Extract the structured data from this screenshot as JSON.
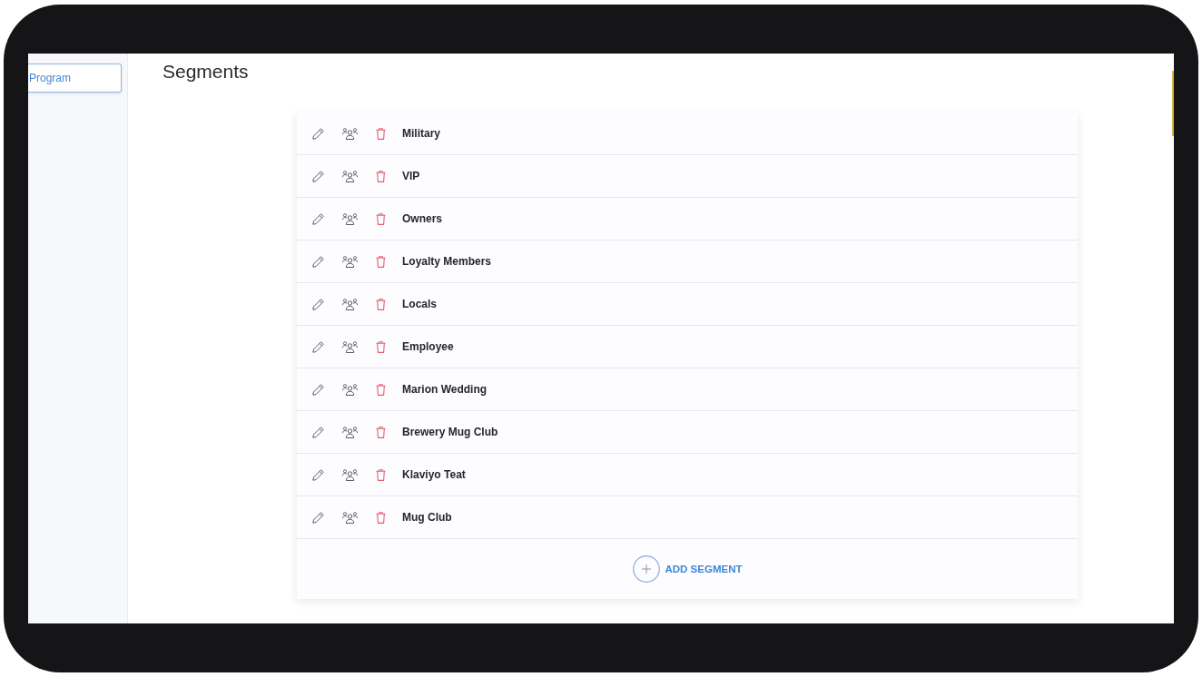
{
  "sidebar": {
    "button": "Program"
  },
  "page": {
    "title": "Segments"
  },
  "segments": [
    {
      "name": "Military"
    },
    {
      "name": "VIP"
    },
    {
      "name": "Owners"
    },
    {
      "name": "Loyalty Members"
    },
    {
      "name": "Locals"
    },
    {
      "name": "Employee"
    },
    {
      "name": "Marion Wedding"
    },
    {
      "name": "Brewery Mug Club"
    },
    {
      "name": "Klaviyo Teat"
    },
    {
      "name": "Mug Club"
    }
  ],
  "add_button": {
    "label": "ADD SEGMENT"
  }
}
